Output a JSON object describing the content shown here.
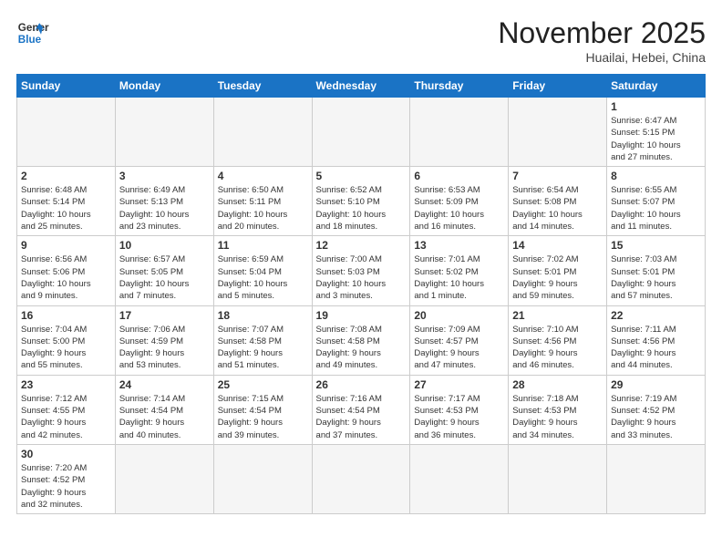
{
  "logo": {
    "line1": "General",
    "line2": "Blue"
  },
  "title": "November 2025",
  "location": "Huailai, Hebei, China",
  "weekdays": [
    "Sunday",
    "Monday",
    "Tuesday",
    "Wednesday",
    "Thursday",
    "Friday",
    "Saturday"
  ],
  "weeks": [
    [
      {
        "day": "",
        "info": ""
      },
      {
        "day": "",
        "info": ""
      },
      {
        "day": "",
        "info": ""
      },
      {
        "day": "",
        "info": ""
      },
      {
        "day": "",
        "info": ""
      },
      {
        "day": "",
        "info": ""
      },
      {
        "day": "1",
        "info": "Sunrise: 6:47 AM\nSunset: 5:15 PM\nDaylight: 10 hours\nand 27 minutes."
      }
    ],
    [
      {
        "day": "2",
        "info": "Sunrise: 6:48 AM\nSunset: 5:14 PM\nDaylight: 10 hours\nand 25 minutes."
      },
      {
        "day": "3",
        "info": "Sunrise: 6:49 AM\nSunset: 5:13 PM\nDaylight: 10 hours\nand 23 minutes."
      },
      {
        "day": "4",
        "info": "Sunrise: 6:50 AM\nSunset: 5:11 PM\nDaylight: 10 hours\nand 20 minutes."
      },
      {
        "day": "5",
        "info": "Sunrise: 6:52 AM\nSunset: 5:10 PM\nDaylight: 10 hours\nand 18 minutes."
      },
      {
        "day": "6",
        "info": "Sunrise: 6:53 AM\nSunset: 5:09 PM\nDaylight: 10 hours\nand 16 minutes."
      },
      {
        "day": "7",
        "info": "Sunrise: 6:54 AM\nSunset: 5:08 PM\nDaylight: 10 hours\nand 14 minutes."
      },
      {
        "day": "8",
        "info": "Sunrise: 6:55 AM\nSunset: 5:07 PM\nDaylight: 10 hours\nand 11 minutes."
      }
    ],
    [
      {
        "day": "9",
        "info": "Sunrise: 6:56 AM\nSunset: 5:06 PM\nDaylight: 10 hours\nand 9 minutes."
      },
      {
        "day": "10",
        "info": "Sunrise: 6:57 AM\nSunset: 5:05 PM\nDaylight: 10 hours\nand 7 minutes."
      },
      {
        "day": "11",
        "info": "Sunrise: 6:59 AM\nSunset: 5:04 PM\nDaylight: 10 hours\nand 5 minutes."
      },
      {
        "day": "12",
        "info": "Sunrise: 7:00 AM\nSunset: 5:03 PM\nDaylight: 10 hours\nand 3 minutes."
      },
      {
        "day": "13",
        "info": "Sunrise: 7:01 AM\nSunset: 5:02 PM\nDaylight: 10 hours\nand 1 minute."
      },
      {
        "day": "14",
        "info": "Sunrise: 7:02 AM\nSunset: 5:01 PM\nDaylight: 9 hours\nand 59 minutes."
      },
      {
        "day": "15",
        "info": "Sunrise: 7:03 AM\nSunset: 5:01 PM\nDaylight: 9 hours\nand 57 minutes."
      }
    ],
    [
      {
        "day": "16",
        "info": "Sunrise: 7:04 AM\nSunset: 5:00 PM\nDaylight: 9 hours\nand 55 minutes."
      },
      {
        "day": "17",
        "info": "Sunrise: 7:06 AM\nSunset: 4:59 PM\nDaylight: 9 hours\nand 53 minutes."
      },
      {
        "day": "18",
        "info": "Sunrise: 7:07 AM\nSunset: 4:58 PM\nDaylight: 9 hours\nand 51 minutes."
      },
      {
        "day": "19",
        "info": "Sunrise: 7:08 AM\nSunset: 4:58 PM\nDaylight: 9 hours\nand 49 minutes."
      },
      {
        "day": "20",
        "info": "Sunrise: 7:09 AM\nSunset: 4:57 PM\nDaylight: 9 hours\nand 47 minutes."
      },
      {
        "day": "21",
        "info": "Sunrise: 7:10 AM\nSunset: 4:56 PM\nDaylight: 9 hours\nand 46 minutes."
      },
      {
        "day": "22",
        "info": "Sunrise: 7:11 AM\nSunset: 4:56 PM\nDaylight: 9 hours\nand 44 minutes."
      }
    ],
    [
      {
        "day": "23",
        "info": "Sunrise: 7:12 AM\nSunset: 4:55 PM\nDaylight: 9 hours\nand 42 minutes."
      },
      {
        "day": "24",
        "info": "Sunrise: 7:14 AM\nSunset: 4:54 PM\nDaylight: 9 hours\nand 40 minutes."
      },
      {
        "day": "25",
        "info": "Sunrise: 7:15 AM\nSunset: 4:54 PM\nDaylight: 9 hours\nand 39 minutes."
      },
      {
        "day": "26",
        "info": "Sunrise: 7:16 AM\nSunset: 4:54 PM\nDaylight: 9 hours\nand 37 minutes."
      },
      {
        "day": "27",
        "info": "Sunrise: 7:17 AM\nSunset: 4:53 PM\nDaylight: 9 hours\nand 36 minutes."
      },
      {
        "day": "28",
        "info": "Sunrise: 7:18 AM\nSunset: 4:53 PM\nDaylight: 9 hours\nand 34 minutes."
      },
      {
        "day": "29",
        "info": "Sunrise: 7:19 AM\nSunset: 4:52 PM\nDaylight: 9 hours\nand 33 minutes."
      }
    ],
    [
      {
        "day": "30",
        "info": "Sunrise: 7:20 AM\nSunset: 4:52 PM\nDaylight: 9 hours\nand 32 minutes."
      },
      {
        "day": "",
        "info": ""
      },
      {
        "day": "",
        "info": ""
      },
      {
        "day": "",
        "info": ""
      },
      {
        "day": "",
        "info": ""
      },
      {
        "day": "",
        "info": ""
      },
      {
        "day": "",
        "info": ""
      }
    ]
  ]
}
